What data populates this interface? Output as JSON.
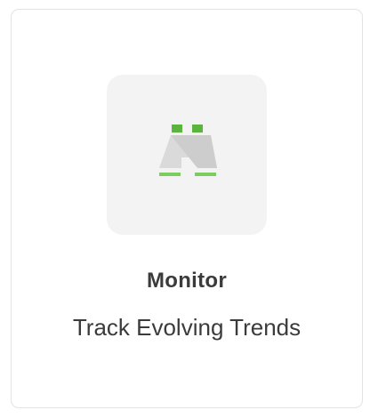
{
  "card": {
    "icon": "binoculars-icon",
    "title": "Monitor",
    "subtitle": "Track Evolving Trends"
  },
  "colors": {
    "accent_green": "#5cb43f",
    "icon_gray_light": "#d9d9d9",
    "icon_gray_dark": "#c9c9c9",
    "tile_background": "#f3f3f3",
    "text": "#3b3b3b",
    "border": "#e3e3e3"
  }
}
